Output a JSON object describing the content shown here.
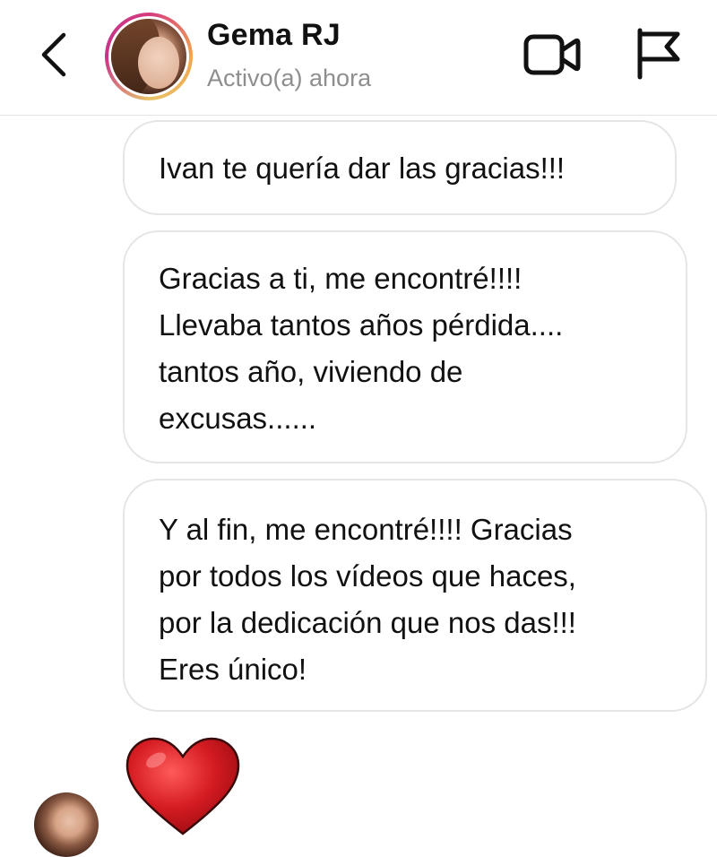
{
  "header": {
    "name": "Gema RJ",
    "status": "Activo(a) ahora",
    "icons": {
      "back": "chevron-left-icon",
      "video_call": "video-camera-icon",
      "report": "flag-icon"
    }
  },
  "messages": [
    {
      "text": "Ivan te quería dar las gracias!!!"
    },
    {
      "text": "Gracias a ti, me encontré!!!!\nLlevaba tantos años pérdida....\ntantos año, viviendo de\nexcusas......"
    },
    {
      "text": "Y al fin, me encontré!!!! Gracias\npor todos los vídeos que haces,\npor la dedicación que nos das!!!\nEres único!"
    }
  ],
  "reaction": {
    "emoji": "heart-icon",
    "color": "#c8161d"
  },
  "colors": {
    "bubble_border": "#e5e5e5",
    "status_text": "#8e8e8e",
    "story_ring": [
      "#d43a7f",
      "#f2a64d",
      "#c4338b"
    ]
  }
}
